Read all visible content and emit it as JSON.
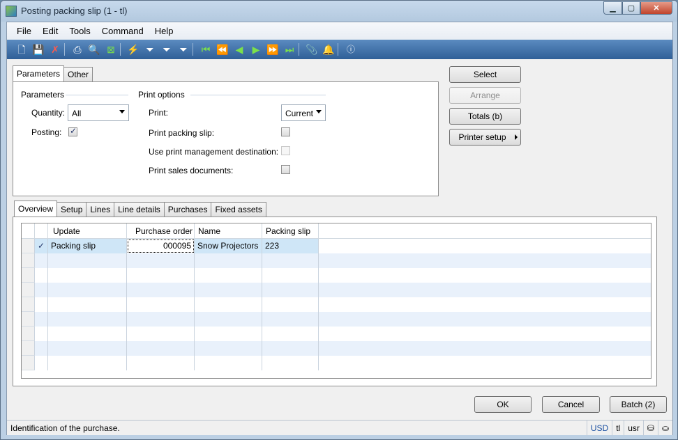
{
  "window": {
    "title": "Posting packing slip (1 - tl)"
  },
  "menu": [
    "File",
    "Edit",
    "Tools",
    "Command",
    "Help"
  ],
  "toolbar_icons": [
    "new-icon",
    "save-icon",
    "delete-icon",
    "print-icon",
    "print-preview-icon",
    "excel-icon",
    "filter-by-selection-icon",
    "filter-by-grid-icon",
    "advanced-filter-icon",
    "remove-filter-icon",
    "first-record-icon",
    "previous-page-icon",
    "previous-record-icon",
    "next-record-icon",
    "next-page-icon",
    "last-record-icon",
    "attachments-icon",
    "alert-icon",
    "help-icon"
  ],
  "top_tabs": {
    "parameters": "Parameters",
    "other": "Other"
  },
  "parameters": {
    "group_title": "Parameters",
    "quantity_label": "Quantity:",
    "quantity_value": "All",
    "posting_label": "Posting:",
    "posting_checked": true
  },
  "print_options": {
    "group_title": "Print options",
    "print_label": "Print:",
    "print_value": "Current",
    "print_packing_slip_label": "Print packing slip:",
    "print_packing_slip_checked": false,
    "use_print_mgmt_label": "Use print management destination:",
    "use_print_mgmt_checked": false,
    "print_sales_docs_label": "Print sales documents:",
    "print_sales_docs_checked": false
  },
  "side_buttons": {
    "select": "Select",
    "arrange": "Arrange",
    "totals": "Totals (b)",
    "printer_setup": "Printer setup"
  },
  "bottom_tabs": [
    "Overview",
    "Setup",
    "Lines",
    "Line details",
    "Purchases",
    "Fixed assets"
  ],
  "grid": {
    "columns": [
      "Update",
      "Purchase order",
      "Name",
      "Packing slip"
    ],
    "rows": [
      {
        "marked": true,
        "update": "Packing slip",
        "purchase_order": "000095",
        "name": "Snow Projectors",
        "packing_slip": "223"
      }
    ]
  },
  "footer_buttons": {
    "ok": "OK",
    "cancel": "Cancel",
    "batch": "Batch (2)"
  },
  "status": {
    "message": "Identification of the purchase.",
    "currency": "USD",
    "company": "tl",
    "user": "usr"
  }
}
